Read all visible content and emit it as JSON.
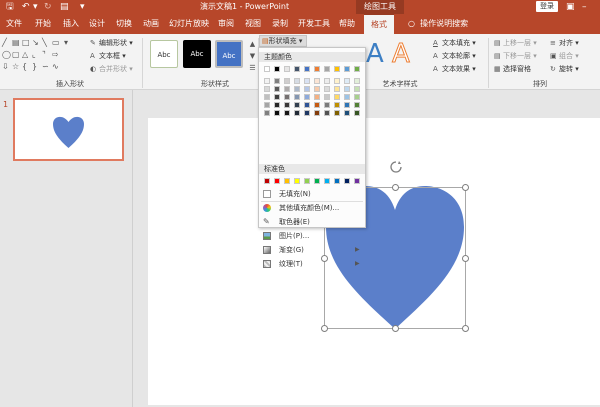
{
  "titlebar": {
    "title": "演示文稿1  -  PowerPoint",
    "context_tab": "绘图工具",
    "login": "登录"
  },
  "menu": {
    "tabs": [
      "文件",
      "开始",
      "插入",
      "设计",
      "切换",
      "动画",
      "幻灯片放映",
      "审阅",
      "视图",
      "录制",
      "开发工具",
      "帮助",
      "格式"
    ],
    "active_tab": "格式",
    "tell_me": "操作说明搜索"
  },
  "ribbon": {
    "insert_shapes": {
      "label": "插入形状",
      "edit_shape": "编辑形状",
      "text_box": "文本框",
      "merge_shapes": "合并形状"
    },
    "shape_styles": {
      "label": "形状样式",
      "swatch_text": "Abc",
      "fill_button": "形状填充"
    },
    "wordart": {
      "label": "艺术字样式",
      "text_fill": "文本填充",
      "text_outline": "文本轮廓",
      "text_effects": "文本效果"
    },
    "arrange": {
      "label": "排列",
      "bring_forward": "上移一层",
      "send_backward": "下移一层",
      "selection_pane": "选择窗格",
      "align": "对齐",
      "group": "组合",
      "rotate": "旋转"
    }
  },
  "thumbnails": {
    "slide_number": "1"
  },
  "fill_menu": {
    "theme_colors_label": "主题颜色",
    "standard_colors_label": "标准色",
    "theme_top_row": [
      "#ffffff",
      "#000000",
      "#e7e6e6",
      "#44546a",
      "#4472c4",
      "#ed7d31",
      "#a5a5a5",
      "#ffc000",
      "#5b9bd5",
      "#70ad47"
    ],
    "theme_shades": [
      [
        "#f2f2f2",
        "#7f7f7f",
        "#d0cece",
        "#d6dce4",
        "#d9e2f3",
        "#fbe5d5",
        "#ededed",
        "#fff2cc",
        "#deebf6",
        "#e2efd9"
      ],
      [
        "#d8d8d8",
        "#595959",
        "#aeabab",
        "#adb9ca",
        "#b4c6e7",
        "#f7cbac",
        "#dbdbdb",
        "#fee599",
        "#bdd7ee",
        "#c5e0b3"
      ],
      [
        "#bfbfbf",
        "#3f3f3f",
        "#757070",
        "#8496b0",
        "#8eaadb",
        "#f4b183",
        "#c9c9c9",
        "#ffd965",
        "#9cc3e5",
        "#a8d08d"
      ],
      [
        "#a5a5a5",
        "#262626",
        "#3a3838",
        "#323f4f",
        "#2f5496",
        "#c55a11",
        "#7b7b7b",
        "#bf8f00",
        "#2e75b5",
        "#538135"
      ],
      [
        "#7f7f7f",
        "#0c0c0c",
        "#171616",
        "#222a35",
        "#1f3864",
        "#833c0b",
        "#525252",
        "#7f6000",
        "#1e4e79",
        "#375623"
      ]
    ],
    "standard_colors": [
      "#c00000",
      "#ff0000",
      "#ffc000",
      "#ffff00",
      "#92d050",
      "#00b050",
      "#00b0f0",
      "#0070c0",
      "#002060",
      "#7030a0"
    ],
    "items": [
      {
        "label": "无填充(N)",
        "icon": "no-fill-icon",
        "submenu": false
      },
      {
        "label": "其他填充颜色(M)...",
        "icon": "color-wheel-icon",
        "submenu": false
      },
      {
        "label": "取色器(E)",
        "icon": "eyedropper-icon",
        "submenu": false
      },
      {
        "label": "图片(P)...",
        "icon": "picture-icon",
        "submenu": false
      },
      {
        "label": "渐变(G)",
        "icon": "gradient-icon",
        "submenu": true
      },
      {
        "label": "纹理(T)",
        "icon": "texture-icon",
        "submenu": true
      }
    ]
  },
  "colors": {
    "accent": "#b7472a",
    "heart": "#5b7fca",
    "style_swatch_selected": "#4472c4"
  }
}
